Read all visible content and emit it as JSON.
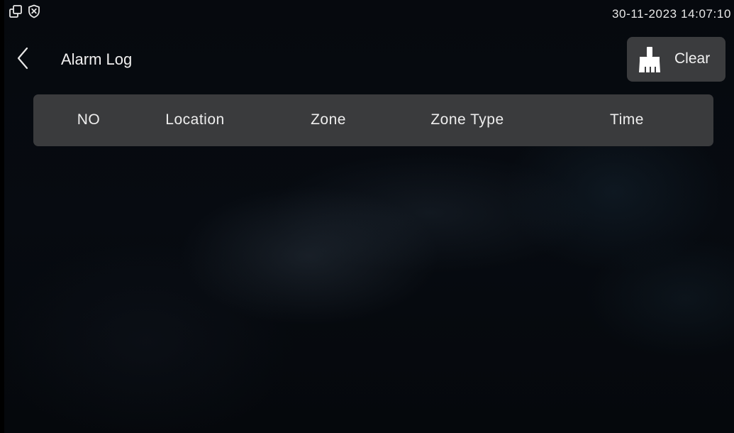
{
  "status_bar": {
    "icons": [
      "multi-window-icon",
      "shield-x-icon"
    ],
    "datetime": "30-11-2023 14:07:10"
  },
  "header": {
    "back_icon": "chevron-left-icon",
    "title": "Alarm Log",
    "clear_button": {
      "icon": "broom-icon",
      "label": "Clear"
    }
  },
  "table": {
    "columns": [
      "NO",
      "Location",
      "Zone",
      "Zone Type",
      "Time"
    ],
    "rows": []
  },
  "colors": {
    "panel": "#3a3b3d",
    "button": "#3b3c3e",
    "text": "#eeeeee",
    "background": "#05080d"
  }
}
